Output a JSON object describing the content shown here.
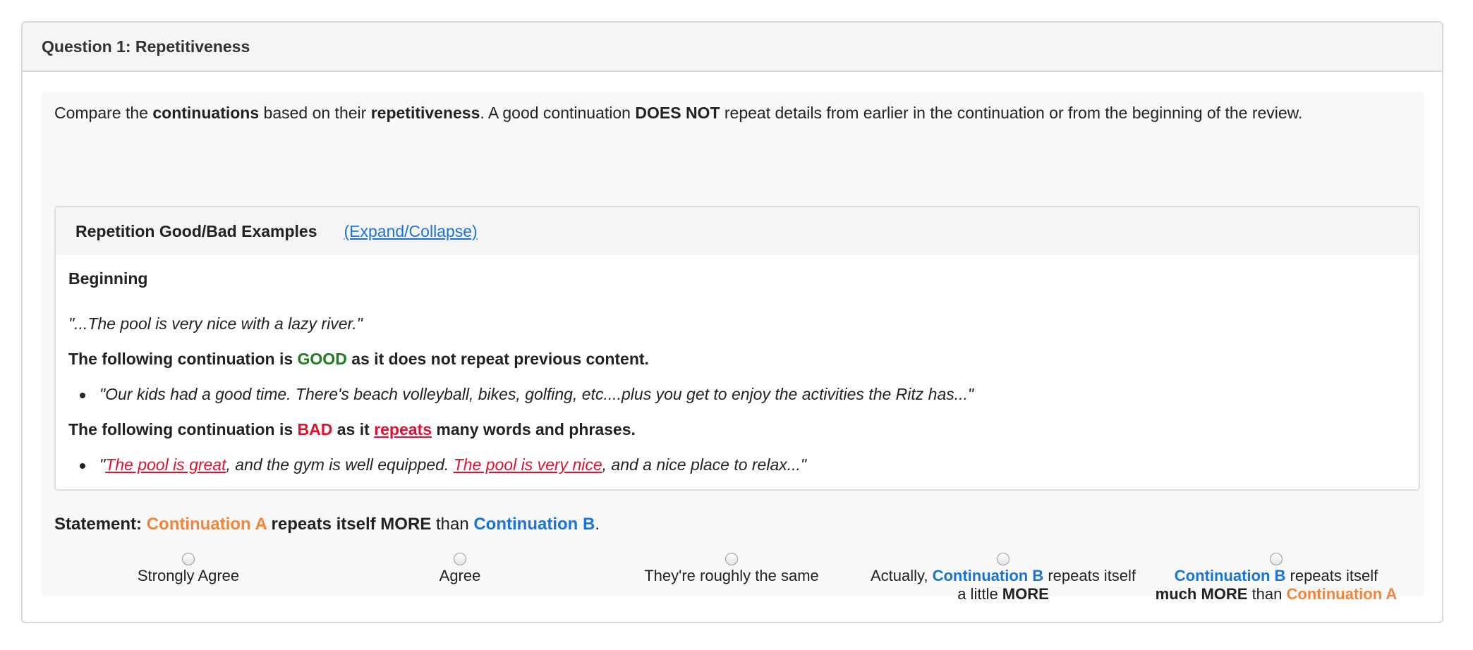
{
  "question": {
    "title": "Question 1: Repetitiveness"
  },
  "intro": {
    "p1": "Compare the ",
    "b1": "continuations",
    "p2": " based on their ",
    "b2": "repetitiveness",
    "p3": ". A good continuation ",
    "b3": "DOES NOT",
    "p4": " repeat details from earlier in the continuation or from the beginning of the review."
  },
  "examples": {
    "title": "Repetition Good/Bad Examples",
    "toggle": "(Expand/Collapse)",
    "beginning_label": "Beginning",
    "beginning_text": "\"...The pool is very nice with a lazy river.\"",
    "good_line": {
      "pre": "The following continuation is ",
      "tag": "GOOD",
      "post": " as it does not repeat previous content."
    },
    "good_example": "\"Our kids had a good time. There's beach volleyball, bikes, golfing, etc....plus you get to enjoy the activities the Ritz has...\"",
    "bad_line": {
      "pre": "The following continuation is ",
      "tag": "BAD",
      "mid": " as it ",
      "rep": "repeats",
      "post": " many words and phrases."
    },
    "bad_example": {
      "q": "\"",
      "r1": "The pool is great",
      "t1": ", and the gym is well equipped. ",
      "r2": "The pool is very nice",
      "t2": ", and a nice place to relax...\""
    }
  },
  "statement": {
    "label": "Statement:",
    "a": "Continuation A",
    "mid": " repeats itself MORE",
    "than": " than ",
    "b": "Continuation B",
    "end": "."
  },
  "options": [
    {
      "label": "Strongly Agree"
    },
    {
      "label": "Agree"
    },
    {
      "label": "They're roughly the same"
    },
    {
      "pre": "Actually, ",
      "b": "Continuation B",
      "post": " repeats itself a little ",
      "strong": "MORE"
    },
    {
      "b": "Continuation B",
      "post": " repeats itself ",
      "strong": "much MORE",
      "than": " than ",
      "a": "Continuation A"
    }
  ],
  "colors": {
    "good": "#1a7f1a",
    "bad": "#e0102e",
    "continuation_a": "#f5843a",
    "continuation_b": "#1a73d9",
    "link": "#1a73d9"
  }
}
